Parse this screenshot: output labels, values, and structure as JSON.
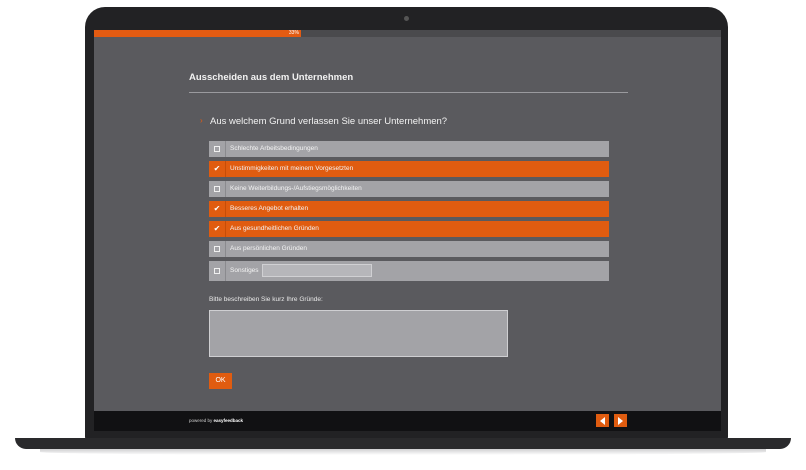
{
  "progress": {
    "percent": 33,
    "label": "33%"
  },
  "page_title": "Ausscheiden aus dem Unternehmen",
  "question": {
    "marker": "›",
    "text": "Aus welchem Grund verlassen Sie unser Unternehmen?"
  },
  "options": [
    {
      "label": "Schlechte Arbeitsbedingungen",
      "checked": false
    },
    {
      "label": "Unstimmigkeiten mit meinem Vorgesetzten",
      "checked": true
    },
    {
      "label": "Keine Weiterbildungs-/Aufstiegsmöglichkeiten",
      "checked": false
    },
    {
      "label": "Besseres Angebot erhalten",
      "checked": true
    },
    {
      "label": "Aus gesundheitlichen Gründen",
      "checked": true
    },
    {
      "label": "Aus persönlichen Gründen",
      "checked": false
    }
  ],
  "other_option": {
    "label": "Sonstiges",
    "checked": false,
    "value": ""
  },
  "description": {
    "label": "Bitte beschreiben Sie kurz Ihre Gründe:",
    "value": ""
  },
  "ok_label": "OK",
  "footer": {
    "powered_prefix": "powered by",
    "brand": "easyfeedback"
  },
  "colors": {
    "accent": "#e05c10",
    "background": "#5a5a5e",
    "option": "#a3a3a7"
  },
  "icons": {
    "prev": "chevron-left-icon",
    "next": "chevron-right-icon",
    "check": "check-icon"
  }
}
